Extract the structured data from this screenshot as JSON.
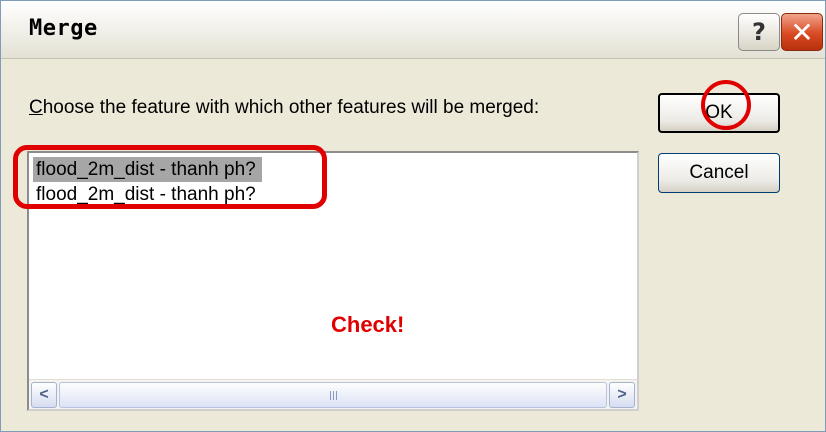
{
  "dialog": {
    "title": "Merge",
    "help_glyph": "?",
    "close_glyph": "✕",
    "prompt_accel": "C",
    "prompt_rest": "hoose the feature with which other features will be merged:",
    "list_items": [
      "flood_2m_dist - thanh ph?",
      "flood_2m_dist - thanh ph?"
    ],
    "selected_index": 0,
    "scroll_left_glyph": "<",
    "scroll_right_glyph": ">",
    "ok_label": "OK",
    "cancel_label": "Cancel"
  },
  "annotation": {
    "note_text": "Check!",
    "color": "#E00000"
  },
  "colors": {
    "dialog_bg": "#ECE9D8",
    "close_button": "#D84A22",
    "selection": "#A6A6A6"
  }
}
